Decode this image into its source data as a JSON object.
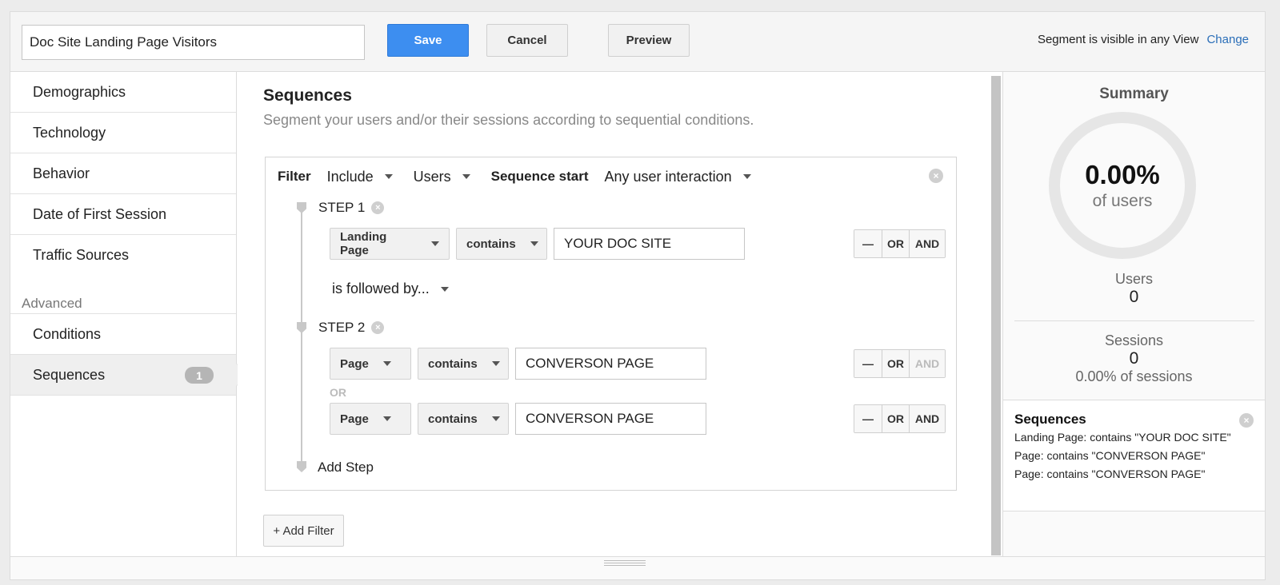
{
  "header": {
    "segment_name": "Doc Site Landing Page Visitors",
    "save_label": "Save",
    "cancel_label": "Cancel",
    "preview_label": "Preview",
    "visibility_text": "Segment is visible in any View",
    "change_label": "Change"
  },
  "sidebar": {
    "items": [
      "Demographics",
      "Technology",
      "Behavior",
      "Date of First Session",
      "Traffic Sources"
    ],
    "advanced_label": "Advanced",
    "advanced_items": [
      {
        "label": "Conditions",
        "badge": ""
      },
      {
        "label": "Sequences",
        "badge": "1"
      }
    ]
  },
  "main": {
    "title": "Sequences",
    "subtitle": "Segment your users and/or their sessions according to sequential conditions.",
    "filter": {
      "label": "Filter",
      "include": "Include",
      "scope": "Users",
      "sequence_start_label": "Sequence start",
      "sequence_start_value": "Any user interaction"
    },
    "steps": [
      {
        "label": "STEP 1",
        "conditions": [
          {
            "dimension": "Landing Page",
            "operator": "contains",
            "value": "YOUR DOC SITE"
          }
        ],
        "followed_by": "is followed by..."
      },
      {
        "label": "STEP 2",
        "conditions": [
          {
            "dimension": "Page",
            "operator": "contains",
            "value": "CONVERSON PAGE"
          },
          {
            "dimension": "Page",
            "operator": "contains",
            "value": "CONVERSON PAGE"
          }
        ],
        "or_label": "OR"
      }
    ],
    "ops": {
      "minus": "—",
      "or": "OR",
      "and": "AND"
    },
    "add_step_label": "Add Step",
    "add_filter_label": "+ Add Filter"
  },
  "summary": {
    "title": "Summary",
    "percent": "0.00%",
    "percent_sub": "of users",
    "users_label": "Users",
    "users_value": "0",
    "sessions_label": "Sessions",
    "sessions_value": "0",
    "sessions_pct": "0.00% of sessions",
    "sequences_title": "Sequences",
    "sequences_lines": [
      "Landing Page: contains \"YOUR DOC SITE\"",
      "Page: contains \"CONVERSON PAGE\"",
      "Page: contains \"CONVERSON PAGE\""
    ]
  },
  "colors": {
    "accent": "#3d8ef0",
    "link": "#2a6eb8"
  },
  "icons": {
    "remove": "close-circle-icon",
    "dropdown": "caret-down-icon",
    "step": "step-marker-icon"
  }
}
